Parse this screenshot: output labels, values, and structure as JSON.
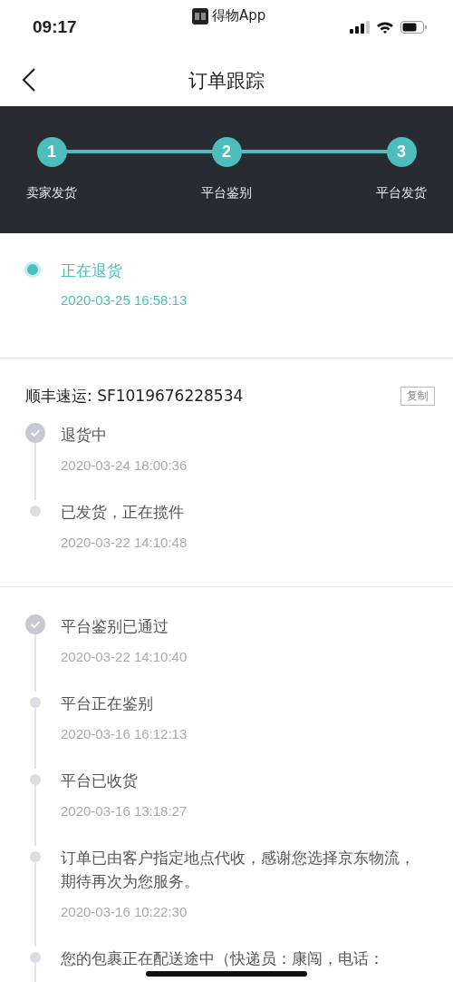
{
  "status_bar": {
    "time": "09:17",
    "app": "得物App"
  },
  "nav": {
    "title": "订单跟踪"
  },
  "steps": [
    {
      "number": "1",
      "label": "卖家发货",
      "done": true
    },
    {
      "number": "2",
      "label": "平台鉴别",
      "done": true
    },
    {
      "number": "3",
      "label": "平台发货",
      "done": true
    }
  ],
  "current": {
    "status": "正在退货",
    "time": "2020-03-25 16:58:13"
  },
  "groups": [
    {
      "carrier": "顺丰速运: SF1019676228534",
      "copy": "复制",
      "events": [
        {
          "kind": "check",
          "title": "退货中",
          "time": "2020-03-24 18:00:36"
        },
        {
          "kind": "dot",
          "title": "已发货，正在揽件",
          "time": "2020-03-22 14:10:48"
        }
      ]
    },
    {
      "events": [
        {
          "kind": "check",
          "title": "平台鉴别已通过",
          "time": "2020-03-22 14:10:40"
        },
        {
          "kind": "dot",
          "title": "平台正在鉴别",
          "time": "2020-03-16 16:12:13"
        },
        {
          "kind": "dot",
          "title": "平台已收货",
          "time": "2020-03-16 13:18:27"
        },
        {
          "kind": "dot",
          "title": "订单已由客户指定地点代收，感谢您选择京东物流，期待再次为您服务。",
          "time": "2020-03-16 10:22:30"
        },
        {
          "kind": "dot",
          "title": "您的包裹正在配送途中（快递员：康闯，电话："
        }
      ]
    }
  ]
}
